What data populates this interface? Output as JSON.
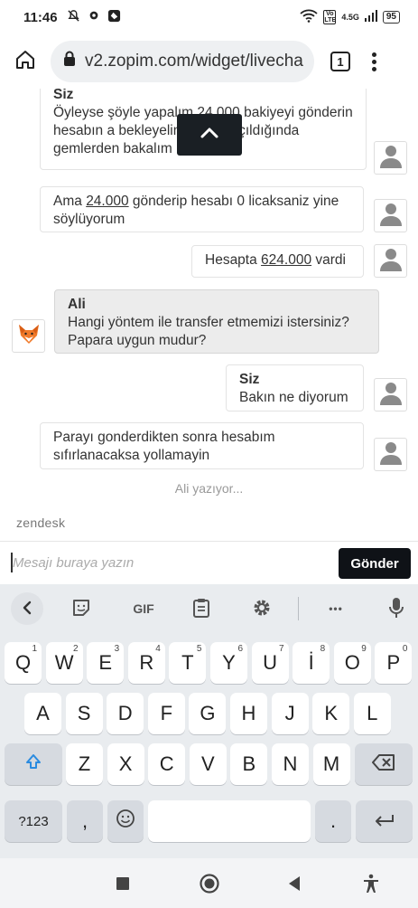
{
  "status_bar": {
    "time": "11:46",
    "network_label": "4.5G",
    "volte_label": "Vo LTE",
    "battery": "95",
    "icons": [
      "mute-icon",
      "settings-icon",
      "shield-app-icon",
      "wifi-icon",
      "signal-icon",
      "battery-icon"
    ]
  },
  "browser": {
    "url": "v2.zopim.com/widget/livecha",
    "tab_count": "1",
    "icons": [
      "home-icon",
      "lock-icon",
      "tabs-icon",
      "menu-icon"
    ]
  },
  "chat": {
    "messages": [
      {
        "from": "visitor",
        "sender": "Siz",
        "text_parts": [
          "Öyleyse şöyle yapalım ",
          "24.000",
          " bakiyeyi gönderin hesabın a",
          "",
          " bekleyelim hesap açıldığında g",
          "",
          "emlerden bakalım"
        ]
      },
      {
        "from": "visitor",
        "text_a": "Ama ",
        "text_amount": "24.000",
        "text_b": " gönderip hesabı 0 licaksaniz yine söylüyorum"
      },
      {
        "from": "visitor",
        "text_a": "Hesapta ",
        "text_amount": "624.000",
        "text_b": " vardi"
      },
      {
        "from": "agent",
        "sender": "Ali",
        "text": "Hangi yöntem ile transfer etmemizi istersiniz? Papara uygun mudur?"
      },
      {
        "from": "visitor",
        "sender": "Siz",
        "text": "Bakın ne diyorum"
      },
      {
        "from": "visitor",
        "text": "Parayı gonderdikten sonra hesabım sıfırlanacaksa yollamayin"
      }
    ],
    "typing_indicator": "Ali yazıyor...",
    "brand": "zendesk"
  },
  "composer": {
    "placeholder": "Mesajı buraya yazın",
    "value": "",
    "send_label": "Gönder"
  },
  "keyboard": {
    "toolbar": [
      "back",
      "sticker",
      "GIF",
      "clipboard",
      "settings",
      "more",
      "mic"
    ],
    "gif_label": "GIF",
    "more_label": "•••",
    "row1": [
      {
        "k": "Q",
        "h": "1"
      },
      {
        "k": "W",
        "h": "2"
      },
      {
        "k": "E",
        "h": "3"
      },
      {
        "k": "R",
        "h": "4"
      },
      {
        "k": "T",
        "h": "5"
      },
      {
        "k": "Y",
        "h": "6"
      },
      {
        "k": "U",
        "h": "7"
      },
      {
        "k": "İ",
        "h": "8"
      },
      {
        "k": "O",
        "h": "9"
      },
      {
        "k": "P",
        "h": "0"
      }
    ],
    "row2": [
      "A",
      "S",
      "D",
      "F",
      "G",
      "H",
      "J",
      "K",
      "L"
    ],
    "row3": [
      "Z",
      "X",
      "C",
      "V",
      "B",
      "N",
      "M"
    ],
    "symbols_label": "?123",
    "comma_label": ",",
    "period_label": "."
  },
  "navigation": [
    "recents-icon",
    "home-icon",
    "back-icon",
    "accessibility-icon"
  ]
}
